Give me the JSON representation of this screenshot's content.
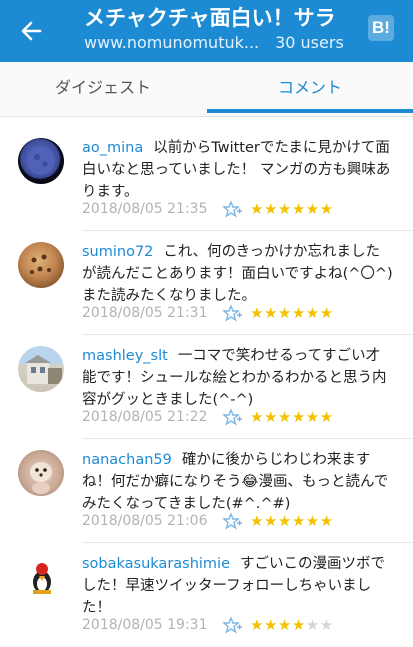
{
  "header": {
    "title": "メチャクチャ面白い！サラ",
    "domain": "www.nomunomutuk...",
    "users": "30 users",
    "hatena_logo": "B!"
  },
  "tabs": [
    {
      "label": "ダイジェスト",
      "active": false
    },
    {
      "label": "コメント",
      "active": true
    }
  ],
  "colors": {
    "accent": "#1d8ad4",
    "star": "#f2c200"
  },
  "comments": [
    {
      "user": "ao_mina",
      "text": "以前からTwitterでたまに見かけて面白いなと思っていました！ マンガの方も興味あります。",
      "date": "2018/08/05 21:35",
      "stars": 6,
      "stars_text": "★★★★★★",
      "star_empty_text": ""
    },
    {
      "user": "sumino72",
      "text": "これ、何のきっかけか忘れましたが読んだことあります！面白いですよね(^〇^) また読みたくなりました。",
      "date": "2018/08/05 21:31",
      "stars": 6,
      "stars_text": "★★★★★★",
      "star_empty_text": ""
    },
    {
      "user": "mashley_slt",
      "text": "一コマで笑わせるってすごい才能です！シュールな絵とわかるわかると思う内容がグッときました(^-^)",
      "date": "2018/08/05 21:22",
      "stars": 6,
      "stars_text": "★★★★★★",
      "star_empty_text": ""
    },
    {
      "user": "nanachan59",
      "text": "確かに後からじわじわ来ますね！何だか癖になりそう😂漫画、もっと読んでみたくなってきました(#^.^#)",
      "date": "2018/08/05 21:06",
      "stars": 6,
      "stars_text": "★★★★★★",
      "star_empty_text": ""
    },
    {
      "user": "sobakasukarashimie",
      "text": "すごいこの漫画ツボでした！早速ツイッターフォローしちゃいました！",
      "date": "2018/08/05 19:31",
      "stars": 4,
      "stars_text": "★★★★",
      "star_empty_text": "★★"
    }
  ]
}
